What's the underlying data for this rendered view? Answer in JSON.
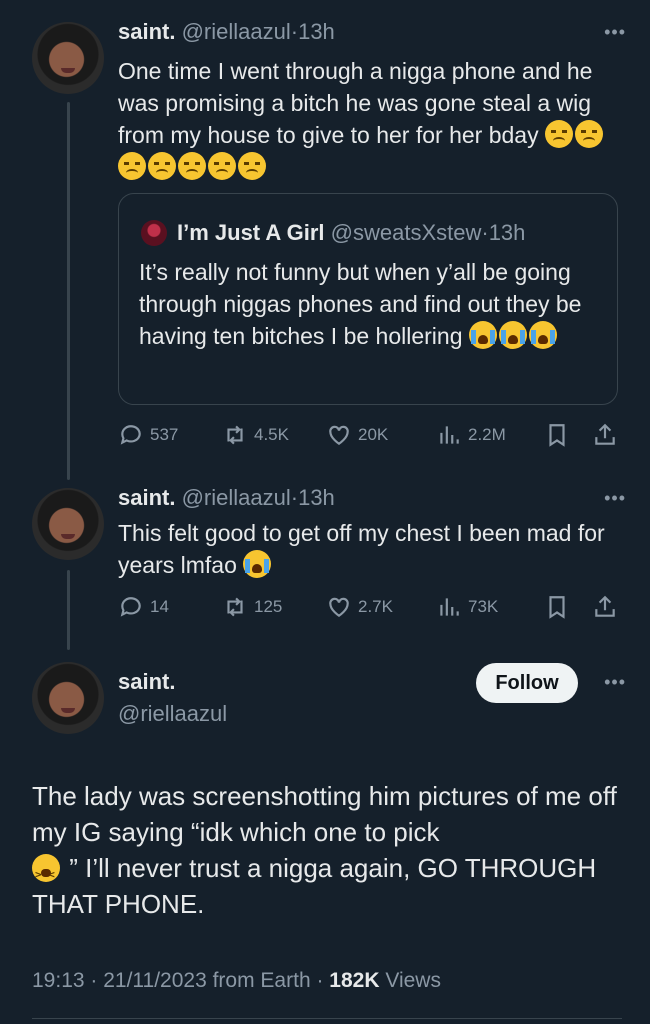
{
  "tweets": [
    {
      "name": "saint.",
      "handle": "@riellaazul",
      "sep": "·",
      "time": "13h",
      "text": "One time I went through a nigga phone and he was promising a bitch he was gone steal a wig from my house to give to her for her bday",
      "emojis": [
        "disappointed-face",
        "disappointed-face",
        "disappointed-face",
        "disappointed-face",
        "disappointed-face",
        "disappointed-face",
        "disappointed-face"
      ],
      "quote": {
        "name": "I’m Just A Girl",
        "handle": "@sweatsXstew",
        "sep": "·",
        "time": "13h",
        "text": "It’s really not funny but when y’all be going through niggas phones and find out they be having ten bitches I be hollering",
        "emojis": [
          "loudly-crying-face",
          "loudly-crying-face",
          "loudly-crying-face"
        ]
      },
      "stats": {
        "replies": "537",
        "reposts": "4.5K",
        "likes": "20K",
        "views": "2.2M"
      }
    },
    {
      "name": "saint.",
      "handle": "@riellaazul",
      "sep": "·",
      "time": "13h",
      "text": "This felt good to get off my chest I been mad for years lmfao",
      "emojis": [
        "loudly-crying-face"
      ],
      "stats": {
        "replies": "14",
        "reposts": "125",
        "likes": "2.7K",
        "views": "73K"
      }
    }
  ],
  "main": {
    "name": "saint.",
    "handle": "@riellaazul",
    "follow_label": "Follow",
    "text_part1": "The lady was screenshotting him pictures of me off my IG saying “idk which one to pick",
    "text_part2": "” I’ll never trust a nigga again, GO THROUGH THAT PHONE.",
    "emoji": "tired-face",
    "meta_time": "19:13 · 21/11/2023 from Earth · ",
    "meta_views_count": "182K",
    "meta_views_label": " Views"
  },
  "more_glyph": "•••",
  "colors": {
    "background": "#15202b",
    "text": "#e7e9ea",
    "muted": "#8b98a5",
    "border": "#38444d",
    "follow_bg": "#eff3f4"
  }
}
